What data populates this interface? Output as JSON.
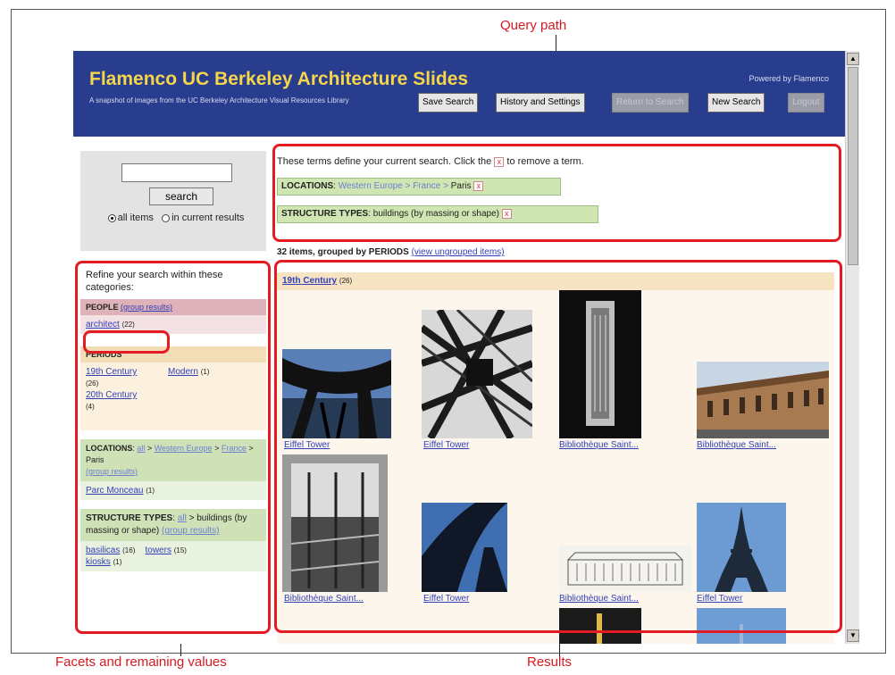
{
  "callouts": {
    "query_path": "Query path",
    "facets": "Facets and remaining values",
    "results": "Results"
  },
  "header": {
    "title": "Flamenco UC Berkeley Architecture Slides",
    "subtitle": "A snapshot of images from the UC Berkeley Architecture Visual Resources Library",
    "powered_by": "Powered by Flamenco",
    "buttons": {
      "save": "Save Search",
      "history": "History and Settings",
      "return": "Return to Search",
      "new": "New Search",
      "logout": "Logout"
    },
    "colors": {
      "background": "#293d8f",
      "title": "#f5d54a"
    }
  },
  "search": {
    "value": "",
    "button": "search",
    "scope_all": "all items",
    "scope_current": "in current results",
    "selected_scope": "all items"
  },
  "facets": {
    "intro": "Refine your search within these categories:",
    "people": {
      "label": "PEOPLE",
      "group_link": "(group results)",
      "value": "architect",
      "count": "(22)"
    },
    "periods": {
      "label": "PERIODS",
      "v1": "19th Century",
      "c1": "(26)",
      "v2": "20th Century",
      "c2": "(4)",
      "v3": "Modern",
      "c3": "(1)"
    },
    "locations": {
      "label": "LOCATIONS",
      "all": "all",
      "sep": ">",
      "p1": "Western Europe",
      "p2": "France",
      "p3": "Paris",
      "group_link": "(group results)",
      "value": "Parc Monceau",
      "count": "(1)"
    },
    "structure": {
      "label": "STRUCTURE TYPES",
      "all": "all",
      "path": "buildings (by massing or shape)",
      "group_link": "(group results)",
      "v1": "basilicas",
      "c1": "(16)",
      "v2": "towers",
      "c2": "(15)",
      "v3": "kiosks",
      "c3": "(1)"
    }
  },
  "query": {
    "instruction_pre": "These terms define your current search. Click the",
    "instruction_x": "x",
    "instruction_post": "to remove a term.",
    "terms": [
      {
        "facet": "LOCATIONS",
        "path": "Western Europe > France >",
        "last": "Paris"
      },
      {
        "facet": "STRUCTURE TYPES",
        "path": "",
        "last": "buildings (by massing or shape)"
      }
    ]
  },
  "results": {
    "count_text": "32 items, grouped by PERIODS",
    "ungroup_link": "(view ungrouped items)",
    "group": {
      "label": "19th Century",
      "count": "(26)"
    },
    "items": [
      {
        "caption": "Eiffel Tower",
        "icon": "eiffel-lattice-photo"
      },
      {
        "caption": "Eiffel Tower",
        "icon": "iron-structure-photo"
      },
      {
        "caption": "Bibliothèque Saint...",
        "icon": "library-plan-photo"
      },
      {
        "caption": "Bibliothèque Saint...",
        "icon": "library-facade-photo"
      },
      {
        "caption": "Bibliothèque Saint...",
        "icon": "library-interior-photo"
      },
      {
        "caption": "Eiffel Tower",
        "icon": "eiffel-base-photo"
      },
      {
        "caption": "Bibliothèque Saint...",
        "icon": "library-elevation-drawing"
      },
      {
        "caption": "Eiffel Tower",
        "icon": "eiffel-full-photo"
      }
    ]
  }
}
